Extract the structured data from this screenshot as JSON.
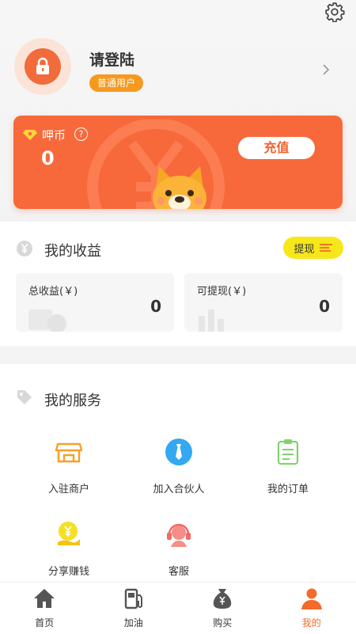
{
  "header": {
    "login_prompt": "请登陆",
    "user_badge": "普通用户"
  },
  "coin_card": {
    "label": "呷币",
    "value": "0",
    "recharge_label": "充值"
  },
  "earnings": {
    "title": "我的收益",
    "withdraw_label": "提现",
    "total_label": "总收益(￥)",
    "total_value": "0",
    "withdrawable_label": "可提现(￥)",
    "withdrawable_value": "0"
  },
  "services": {
    "title": "我的服务",
    "items": [
      {
        "label": "入驻商户",
        "icon": "store-icon"
      },
      {
        "label": "加入合伙人",
        "icon": "tie-icon"
      },
      {
        "label": "我的订单",
        "icon": "clipboard-icon"
      },
      {
        "label": "分享赚钱",
        "icon": "coin-hand-icon"
      },
      {
        "label": "客服",
        "icon": "headset-icon"
      }
    ]
  },
  "tabbar": {
    "items": [
      {
        "label": "首页",
        "icon": "home-icon"
      },
      {
        "label": "加油",
        "icon": "fuel-icon"
      },
      {
        "label": "购买",
        "icon": "money-bag-icon"
      },
      {
        "label": "我的",
        "icon": "person-icon"
      }
    ],
    "active_index": 3,
    "active_color": "#f26b2c"
  },
  "colors": {
    "accent": "#f7693a",
    "badge": "#f59a1f",
    "withdraw": "#f6e71a"
  }
}
